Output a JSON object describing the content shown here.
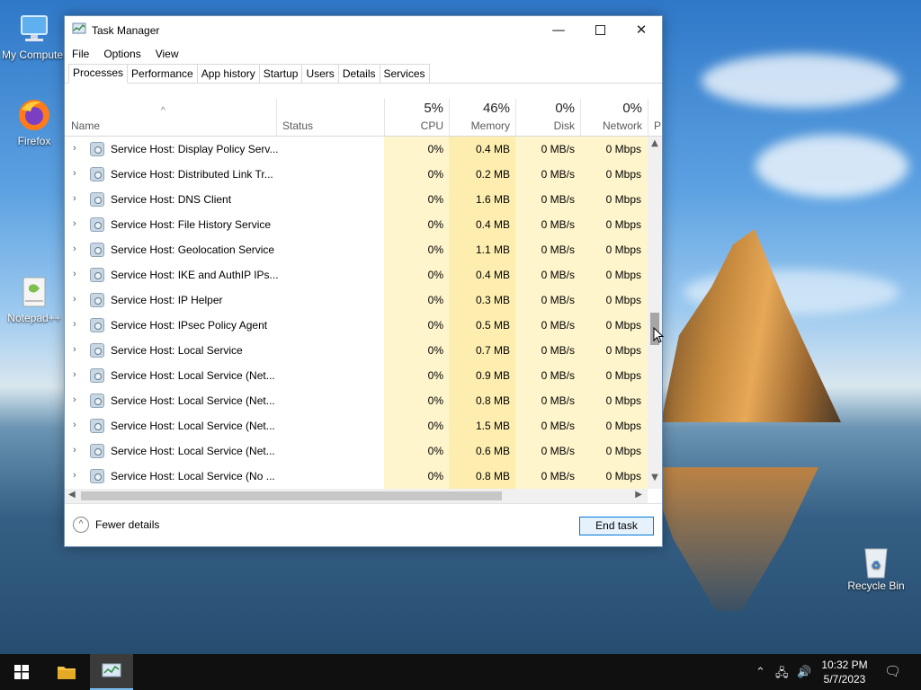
{
  "desktop": {
    "icons": [
      {
        "label": "My Computer"
      },
      {
        "label": "Firefox"
      },
      {
        "label": "Notepad++"
      },
      {
        "label": "Recycle Bin"
      }
    ]
  },
  "window": {
    "title": "Task Manager",
    "menu": [
      "File",
      "Options",
      "View"
    ],
    "tabs": [
      "Processes",
      "Performance",
      "App history",
      "Startup",
      "Users",
      "Details",
      "Services"
    ],
    "active_tab": "Processes"
  },
  "columns": {
    "name": "Name",
    "status": "Status",
    "cpu": {
      "pct": "5%",
      "label": "CPU"
    },
    "memory": {
      "pct": "46%",
      "label": "Memory"
    },
    "disk": {
      "pct": "0%",
      "label": "Disk"
    },
    "network": {
      "pct": "0%",
      "label": "Network"
    },
    "power_partial": "P"
  },
  "rows": [
    {
      "name": "Service Host: Display Policy Serv...",
      "cpu": "0%",
      "memory": "0.4 MB",
      "disk": "0 MB/s",
      "network": "0 Mbps"
    },
    {
      "name": "Service Host: Distributed Link Tr...",
      "cpu": "0%",
      "memory": "0.2 MB",
      "disk": "0 MB/s",
      "network": "0 Mbps"
    },
    {
      "name": "Service Host: DNS Client",
      "cpu": "0%",
      "memory": "1.6 MB",
      "disk": "0 MB/s",
      "network": "0 Mbps"
    },
    {
      "name": "Service Host: File History Service",
      "cpu": "0%",
      "memory": "0.4 MB",
      "disk": "0 MB/s",
      "network": "0 Mbps"
    },
    {
      "name": "Service Host: Geolocation Service",
      "cpu": "0%",
      "memory": "1.1 MB",
      "disk": "0 MB/s",
      "network": "0 Mbps"
    },
    {
      "name": "Service Host: IKE and AuthIP IPs...",
      "cpu": "0%",
      "memory": "0.4 MB",
      "disk": "0 MB/s",
      "network": "0 Mbps"
    },
    {
      "name": "Service Host: IP Helper",
      "cpu": "0%",
      "memory": "0.3 MB",
      "disk": "0 MB/s",
      "network": "0 Mbps"
    },
    {
      "name": "Service Host: IPsec Policy Agent",
      "cpu": "0%",
      "memory": "0.5 MB",
      "disk": "0 MB/s",
      "network": "0 Mbps"
    },
    {
      "name": "Service Host: Local Service",
      "cpu": "0%",
      "memory": "0.7 MB",
      "disk": "0 MB/s",
      "network": "0 Mbps"
    },
    {
      "name": "Service Host: Local Service (Net...",
      "cpu": "0%",
      "memory": "0.9 MB",
      "disk": "0 MB/s",
      "network": "0 Mbps"
    },
    {
      "name": "Service Host: Local Service (Net...",
      "cpu": "0%",
      "memory": "0.8 MB",
      "disk": "0 MB/s",
      "network": "0 Mbps"
    },
    {
      "name": "Service Host: Local Service (Net...",
      "cpu": "0%",
      "memory": "1.5 MB",
      "disk": "0 MB/s",
      "network": "0 Mbps"
    },
    {
      "name": "Service Host: Local Service (Net...",
      "cpu": "0%",
      "memory": "0.6 MB",
      "disk": "0 MB/s",
      "network": "0 Mbps"
    },
    {
      "name": "Service Host: Local Service (No ...",
      "cpu": "0%",
      "memory": "0.8 MB",
      "disk": "0 MB/s",
      "network": "0 Mbps"
    }
  ],
  "footer": {
    "fewer_details": "Fewer details",
    "end_task": "End task"
  },
  "taskbar": {
    "time": "10:32 PM",
    "date": "5/7/2023"
  },
  "colors": {
    "accent": "#0078d7",
    "column_highlight": "#fff5cc",
    "memory_highlight": "#fdeeb0",
    "taskbar": "#101010"
  }
}
